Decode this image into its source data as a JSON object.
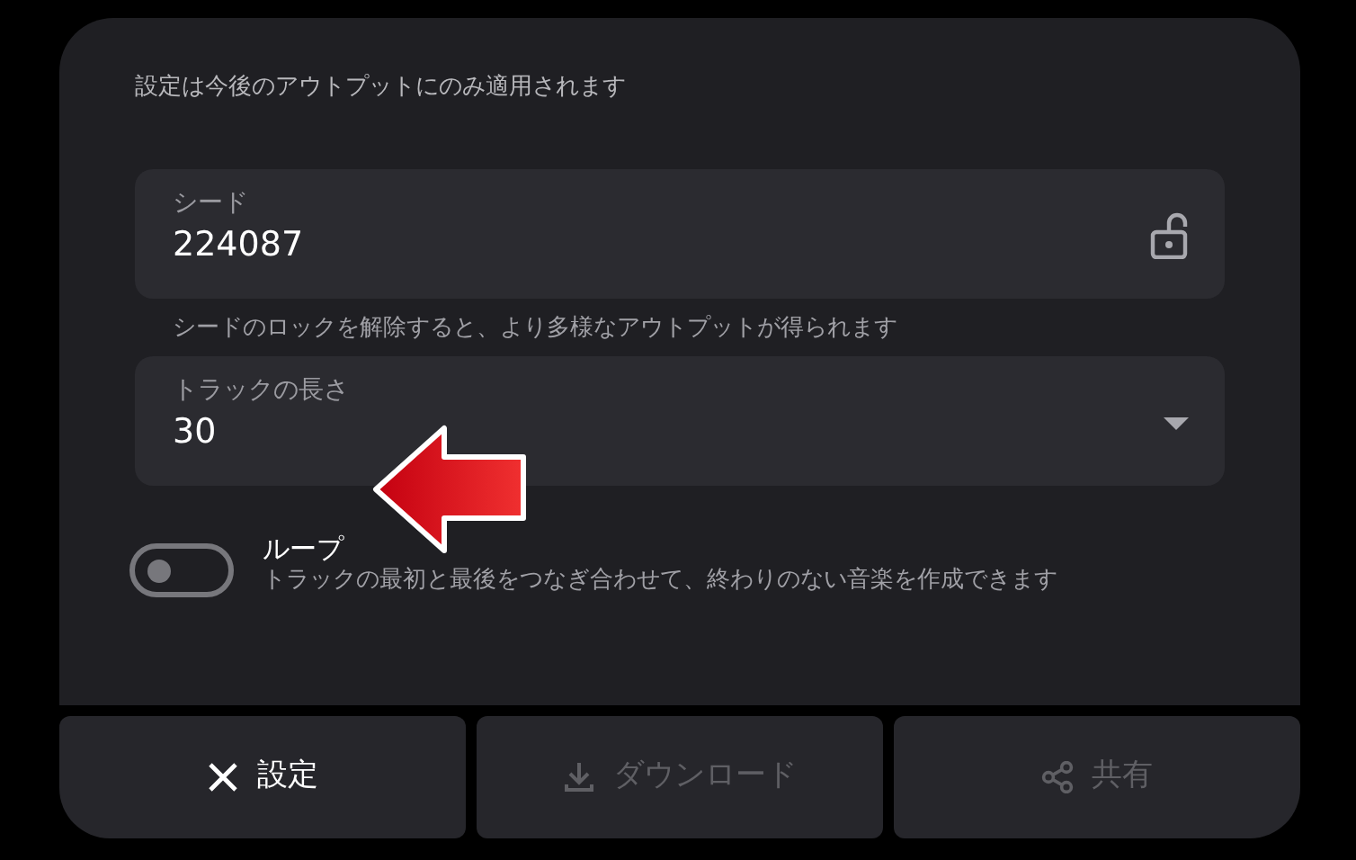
{
  "notice": "設定は今後のアウトプットにのみ適用されます",
  "seed": {
    "label": "シード",
    "value": "224087",
    "locked": false,
    "hint": "シードのロックを解除すると、より多様なアウトプットが得られます"
  },
  "track_length": {
    "label": "トラックの長さ",
    "value": "30"
  },
  "loop": {
    "label": "ループ",
    "description": "トラックの最初と最後をつなぎ合わせて、終わりのない音楽を作成できます",
    "on": false
  },
  "buttons": [
    {
      "label": "設定",
      "kind": "close",
      "disabled": false
    },
    {
      "label": "ダウンロード",
      "kind": "download",
      "disabled": true
    },
    {
      "label": "共有",
      "kind": "share",
      "disabled": true
    }
  ]
}
